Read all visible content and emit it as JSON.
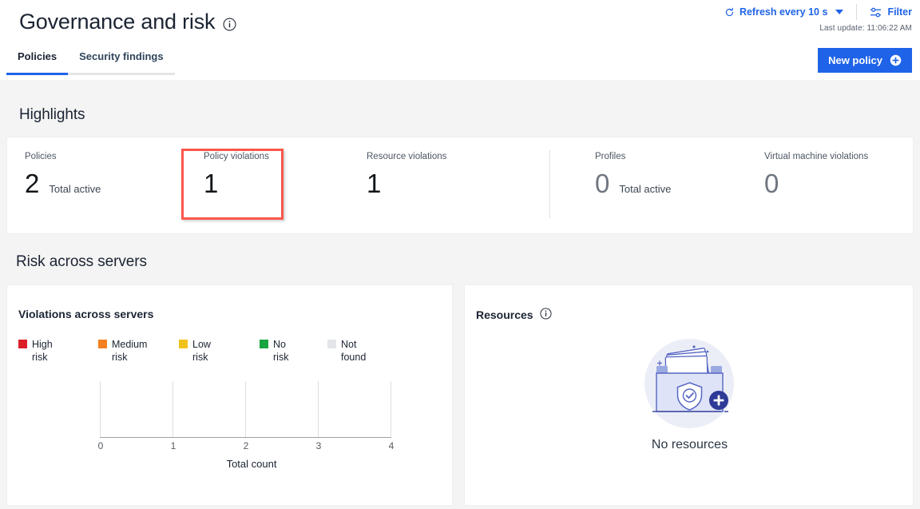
{
  "header": {
    "title": "Governance and risk",
    "title_info_icon": "info-icon",
    "refresh": {
      "icon": "refresh-icon",
      "label": "Refresh every 10 s",
      "caret_icon": "chevron-down-icon"
    },
    "filter": {
      "icon": "filter-icon",
      "label": "Filter"
    },
    "last_update": "Last update:  11:06:22 AM",
    "new_policy": {
      "label": "New policy",
      "icon": "plus-circle-icon"
    },
    "tabs": [
      {
        "label": "Policies",
        "active": true
      },
      {
        "label": "Security findings",
        "active": false
      }
    ]
  },
  "highlights": {
    "heading": "Highlights",
    "selected_metric": "Policy violations",
    "selection_color": "#f9574d",
    "metrics": [
      {
        "label": "Policies",
        "value": "2",
        "sub": "Total active",
        "dim": false
      },
      {
        "label": "Policy violations",
        "value": "1",
        "sub": "",
        "dim": false
      },
      {
        "label": "Resource violations",
        "value": "1",
        "sub": "",
        "dim": false
      },
      {
        "label": "Profiles",
        "value": "0",
        "sub": "Total active",
        "dim": true
      },
      {
        "label": "Virtual machine violations",
        "value": "0",
        "sub": "",
        "dim": true
      }
    ]
  },
  "risk": {
    "heading": "Risk across servers",
    "violations": {
      "title": "Violations across servers",
      "legend": [
        {
          "label": "High risk",
          "color": "#da1e28"
        },
        {
          "label": "Medium risk",
          "color": "#f5801f"
        },
        {
          "label": "Low risk",
          "color": "#f1c21b"
        },
        {
          "label": "No risk",
          "color": "#1aa442"
        },
        {
          "label": "Not found",
          "color": "#e3e5e8"
        }
      ]
    },
    "resources": {
      "title": "Resources",
      "info_icon": "info-icon",
      "empty_illustration": "folder-with-documents-shield-plus-illustration",
      "empty_text": "No resources"
    }
  },
  "chart_data": {
    "type": "bar",
    "title": "Violations across servers",
    "orientation": "horizontal",
    "categories": [],
    "series": [
      {
        "name": "High risk",
        "values": [],
        "color": "#da1e28"
      },
      {
        "name": "Medium risk",
        "values": [],
        "color": "#f5801f"
      },
      {
        "name": "Low risk",
        "values": [],
        "color": "#f1c21b"
      },
      {
        "name": "No risk",
        "values": [],
        "color": "#1aa442"
      },
      {
        "name": "Not found",
        "values": [],
        "color": "#e3e5e8"
      }
    ],
    "xlabel": "Total count",
    "ylabel": "",
    "xticks": [
      "0",
      "1",
      "2",
      "3",
      "4"
    ],
    "xlim": [
      0,
      4
    ],
    "grid": true,
    "legend_position": "top"
  }
}
